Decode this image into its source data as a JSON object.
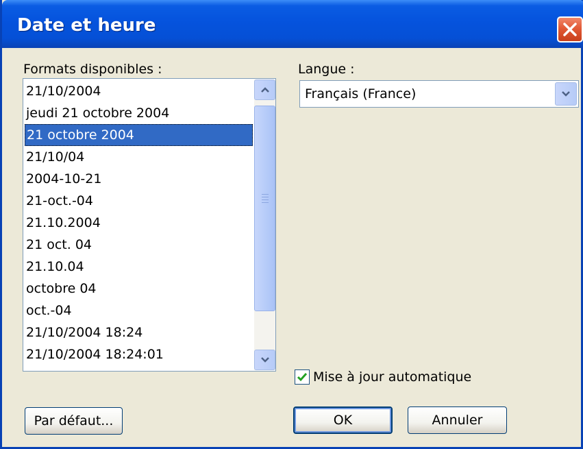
{
  "window": {
    "title": "Date et heure"
  },
  "formats": {
    "label": "Formats disponibles :",
    "items": [
      "21/10/2004",
      "jeudi 21 octobre 2004",
      "21 octobre 2004",
      "21/10/04",
      "2004-10-21",
      "21-oct.-04",
      "21.10.2004",
      "21 oct. 04",
      "21.10.04",
      "octobre 04",
      "oct.-04",
      "21/10/2004 18:24",
      "21/10/2004 18:24:01"
    ],
    "selected": "21 octobre 2004"
  },
  "language": {
    "label": "Langue :",
    "value": "Français (France)"
  },
  "auto_update": {
    "label": "Mise à jour automatique",
    "checked": true
  },
  "buttons": {
    "default_label": "Par défaut...",
    "ok_label": "OK",
    "cancel_label": "Annuler"
  },
  "colors": {
    "titlebar": "#0553dd",
    "selection": "#316ac5",
    "dialog_bg": "#ece9d8",
    "close_button": "#e25a36"
  },
  "icons": {
    "close": "close-icon",
    "scroll_up": "chevron-up-icon",
    "scroll_down": "chevron-down-icon",
    "dropdown": "chevron-down-icon",
    "check": "check-icon"
  }
}
